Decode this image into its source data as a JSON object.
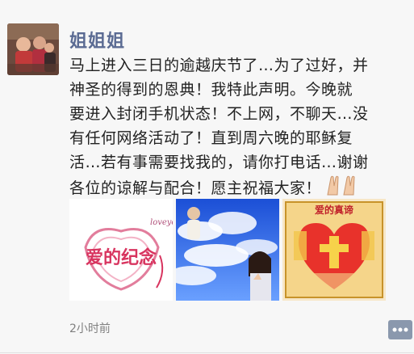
{
  "post": {
    "username": "姐姐姐",
    "lines": [
      "马上进入三日的逾越庆节了…为了过好，并",
      "神圣的得到的恩典！我特此声明。今晚就",
      "要进入封闭手机状态！不上网，不聊天…没",
      "有任何网络活动了！直到周六晚的耶稣复",
      "活…若有事需要找我的，请你打电话…谢谢",
      "各位的谅解与配合！愿主祝福大家！"
    ],
    "emoji": "praying-hands-icon",
    "timestamp": "2小时前",
    "images": [
      {
        "name": "love-memorial-image",
        "caption": "爱的纪念",
        "accent": "#d8345f"
      },
      {
        "name": "jesus-clouds-image",
        "accent": "#2f5fd0"
      },
      {
        "name": "love-truth-image",
        "caption": "爱的真谛",
        "accent": "#e8322b"
      }
    ]
  },
  "colors": {
    "username": "#5b6b93",
    "text": "#222222",
    "timestamp": "#808080",
    "comment_button": "#8a98ad"
  }
}
